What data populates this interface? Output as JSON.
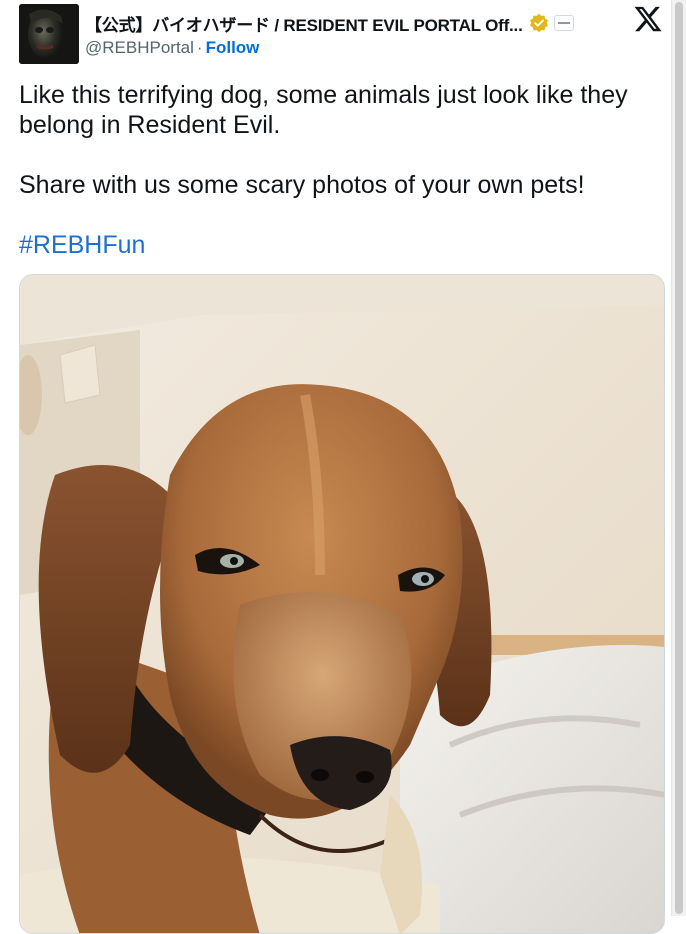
{
  "author": {
    "display_name": "【公式】バイオハザード / RESIDENT EVIL PORTAL Off...",
    "handle": "@REBHPortal",
    "separator": "·",
    "follow_label": "Follow",
    "verified_badge_icon": "gold-verified-badge-icon",
    "affiliate_badge_icon": "affiliate-badge-icon",
    "avatar": "avatar-image"
  },
  "platform_logo": "x-logo-icon",
  "tweet": {
    "line1": "Like this terrifying dog, some animals just look like they belong in Resident Evil.",
    "line2": "Share with us some scary photos of your own pets!",
    "hashtag": "#REBHFun"
  },
  "media": {
    "description_icon": "dog-photo-image"
  },
  "colors": {
    "link": "#1d6fd0",
    "follow": "#006fd6",
    "verified_gold": "#e2b719",
    "text": "#0f1419",
    "muted": "#536471"
  }
}
